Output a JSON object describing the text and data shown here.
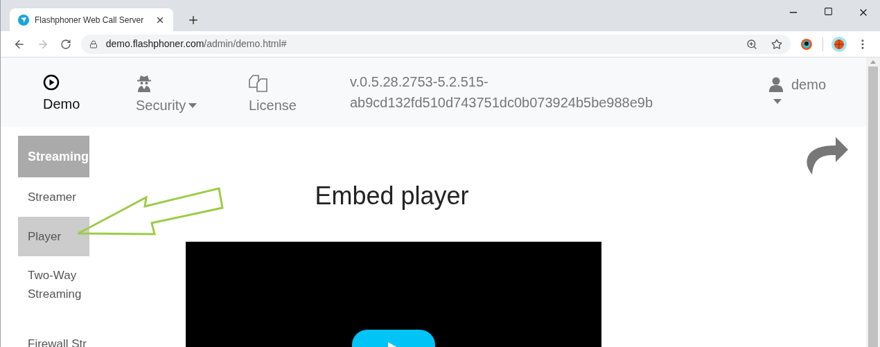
{
  "browser": {
    "tab_title": "Flashphoner Web Call Server",
    "url_host": "demo.flashphoner.com",
    "url_path": "/admin/demo.html#"
  },
  "nav": {
    "items": [
      {
        "label": "Demo",
        "selected": true,
        "dropdown": false
      },
      {
        "label": "Security",
        "selected": false,
        "dropdown": true
      },
      {
        "label": "License",
        "selected": false,
        "dropdown": false
      }
    ],
    "version_lines": [
      "v.0.5.28.2753-5.2.515-",
      "ab9cd132fd510d743751dc0b073924b5be988e9b"
    ],
    "user": "demo"
  },
  "sidebar": {
    "heading": "Streaming",
    "items": [
      {
        "label": "Streamer",
        "selected": false
      },
      {
        "label": "Player",
        "selected": true
      },
      {
        "label": "Two-Way Streaming",
        "selected": false
      },
      {
        "label": "Firewall Str",
        "selected": false
      }
    ]
  },
  "content": {
    "title": "Embed player"
  }
}
